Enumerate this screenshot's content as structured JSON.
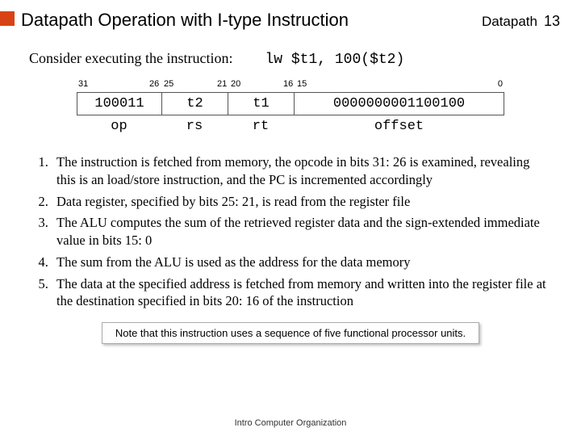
{
  "header": {
    "title": "Datapath Operation with I-type Instruction",
    "section_label": "Datapath",
    "page_number": "13"
  },
  "consider": {
    "prefix": "Consider executing the instruction:",
    "instruction": "lw $t1, 100($t2)"
  },
  "bits": {
    "b31": "31",
    "b26": "26",
    "b25": "25",
    "b21": "21",
    "b20": "20",
    "b16": "16",
    "b15": "15",
    "b0": "0"
  },
  "fields": {
    "op_val": "100011",
    "rs_val": "t2",
    "rt_val": "t1",
    "off_val": "0000000001100100",
    "op_lbl": "op",
    "rs_lbl": "rs",
    "rt_lbl": "rt",
    "off_lbl": "offset"
  },
  "steps": [
    "The instruction is fetched from memory, the opcode in bits 31: 26 is examined, revealing this is an load/store instruction, and the PC is incremented accordingly",
    "Data register, specified by bits 25: 21, is read from the register file",
    "The ALU computes the sum of the retrieved register data and the sign-extended immediate value in bits 15: 0",
    "The sum from the ALU is used as the address for the data memory",
    "The data at the specified address is fetched from memory and written into the register file at the destination specified in bits 20: 16 of the instruction"
  ],
  "note": "Note that this instruction uses a sequence of five functional processor units.",
  "footer": "Intro Computer Organization"
}
